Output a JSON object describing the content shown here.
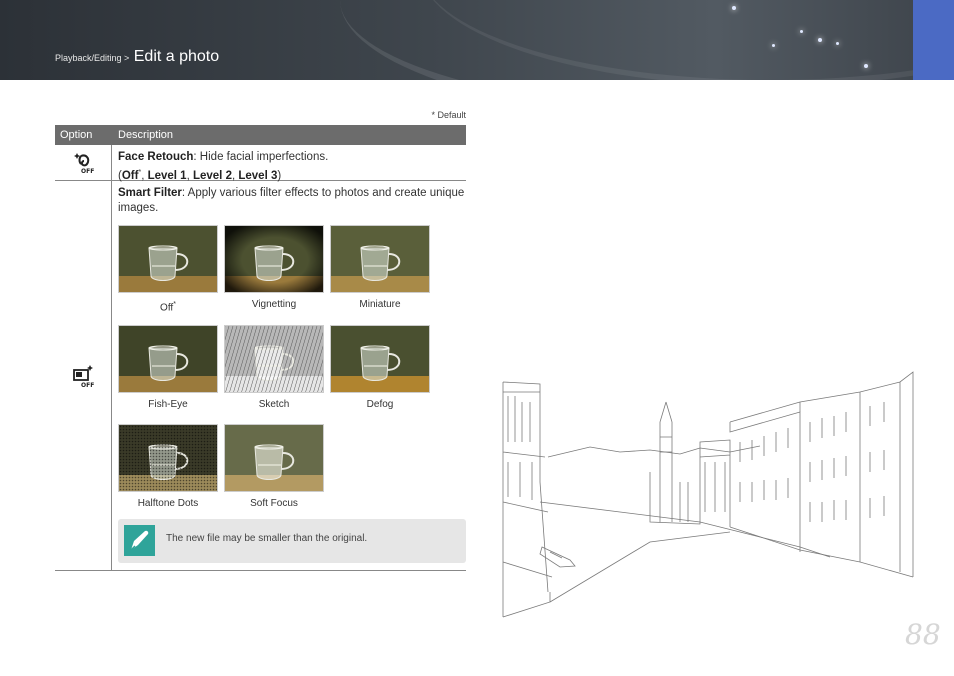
{
  "header": {
    "breadcrumb": "Playback/Editing >",
    "title": "Edit a photo"
  },
  "default_note": "* Default",
  "table": {
    "col_option": "Option",
    "col_description": "Description",
    "face_retouch": {
      "icon": "face-retouch-off-icon",
      "name": "Face Retouch",
      "desc": ": Hide facial imperfections.",
      "open": "(",
      "off": "Off",
      "star": "*",
      "sep1": ", ",
      "level1": "Level 1",
      "sep2": ", ",
      "level2": "Level 2",
      "sep3": ", ",
      "level3": "Level 3",
      "close": ")"
    },
    "smart_filter": {
      "icon": "smart-filter-off-icon",
      "name": "Smart Filter",
      "desc": ": Apply various filter effects to photos and create unique images.",
      "filters": [
        {
          "label": "Off",
          "star": "*"
        },
        {
          "label": "Vignetting"
        },
        {
          "label": "Miniature"
        },
        {
          "label": "Fish-Eye"
        },
        {
          "label": "Sketch"
        },
        {
          "label": "Defog"
        },
        {
          "label": "Halftone Dots"
        },
        {
          "label": "Soft Focus"
        }
      ]
    }
  },
  "note": {
    "icon": "pen-note-icon",
    "text": "The new file may be smaller than the original."
  },
  "page_number": "88"
}
